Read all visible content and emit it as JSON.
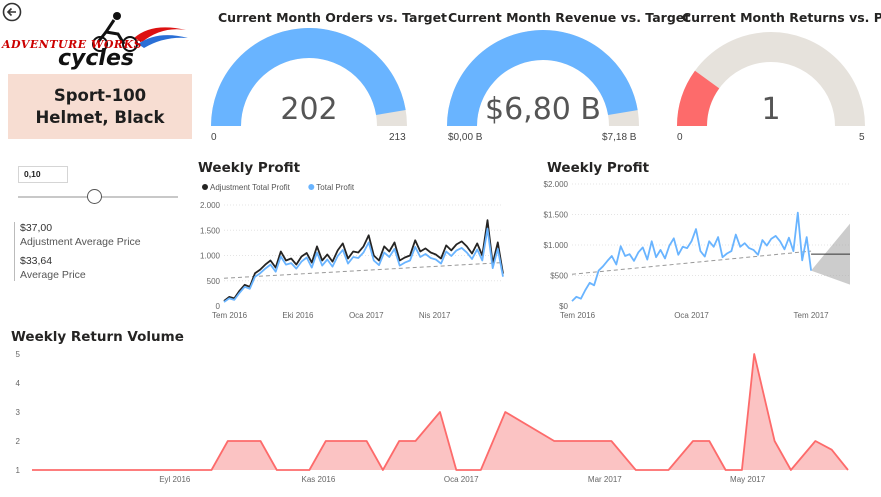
{
  "product": {
    "name": "Sport-100 Helmet, Black"
  },
  "logo": {
    "line1": "ADVENTURE WORKS",
    "line2": "cycles"
  },
  "slicer": {
    "value": "0,10",
    "fraction": 0.48
  },
  "cards": [
    {
      "value": "$37,00",
      "label": "Adjustment Average Price"
    },
    {
      "value": "$33,64",
      "label": "Average Price"
    }
  ],
  "gauges": [
    {
      "title": "Current Month Orders vs. Target",
      "value_text": "202",
      "min_label": "0",
      "max_label": "213",
      "fraction": 0.948,
      "color": "#69b4ff",
      "track": "#e6e2dc"
    },
    {
      "title": "Current Month Revenue vs. Target",
      "value_text": "$6,80 B",
      "min_label": "$0,00 B",
      "max_label": "$7,18 B",
      "fraction": 0.947,
      "color": "#69b4ff",
      "track": "#e6e2dc"
    },
    {
      "title": "Current Month Returns vs. Prev",
      "value_text": "1",
      "min_label": "0",
      "max_label": "5",
      "fraction": 0.2,
      "color": "#fd6b6b",
      "track": "#e6e2dc"
    }
  ],
  "chart_data": [
    {
      "type": "line",
      "title": "Weekly Profit",
      "legend": [
        "Adjustment Total Profit",
        "Total Profit"
      ],
      "legend_position": "top-left",
      "colors": [
        "#252423",
        "#69b4ff"
      ],
      "ylim": [
        0,
        2000
      ],
      "yticks": [
        "0",
        "500",
        "1.000",
        "1.500",
        "2.000"
      ],
      "ytick_values": [
        0,
        500,
        1000,
        1500,
        2000
      ],
      "xticks": [
        {
          "label": "Tem 2016",
          "x": 0.02
        },
        {
          "label": "Eki 2016",
          "x": 0.265
        },
        {
          "label": "Oca 2017",
          "x": 0.51
        },
        {
          "label": "Nis 2017",
          "x": 0.755
        }
      ],
      "grid": true,
      "trend": [
        550,
        860
      ],
      "series": [
        {
          "name": "Adjustment Total Profit",
          "values": [
            100,
            180,
            150,
            300,
            420,
            380,
            650,
            720,
            820,
            900,
            760,
            1080,
            900,
            940,
            820,
            980,
            1050,
            860,
            1180,
            900,
            1020,
            880,
            1100,
            1240,
            940,
            1080,
            1060,
            1180,
            1400,
            1000,
            900,
            1180,
            1080,
            1260,
            900,
            960,
            1000,
            1300,
            1080,
            1140,
            1060,
            1020,
            940,
            1200,
            1100,
            1220,
            1280,
            1180,
            1040,
            1240,
            1000,
            1700,
            840,
            1260,
            640
          ]
        },
        {
          "name": "Total Profit",
          "values": [
            80,
            150,
            120,
            260,
            380,
            340,
            580,
            650,
            740,
            820,
            680,
            980,
            820,
            850,
            740,
            880,
            960,
            760,
            1060,
            800,
            920,
            780,
            990,
            1110,
            840,
            970,
            950,
            1060,
            1260,
            900,
            810,
            1060,
            970,
            1130,
            800,
            860,
            900,
            1170,
            970,
            1030,
            950,
            920,
            840,
            1080,
            990,
            1100,
            1150,
            1060,
            930,
            1120,
            900,
            1530,
            750,
            1130,
            580
          ]
        }
      ]
    },
    {
      "type": "line",
      "title": "Weekly Profit",
      "legend": [],
      "colors": [
        "#69b4ff"
      ],
      "ylim": [
        0,
        2000
      ],
      "yticks": [
        "$0",
        "$500",
        "$1.000",
        "$1.500",
        "$2.000"
      ],
      "ytick_values": [
        0,
        500,
        1000,
        1500,
        2000
      ],
      "xticks": [
        {
          "label": "Tem 2016",
          "x": 0.02
        },
        {
          "label": "Oca 2017",
          "x": 0.43
        },
        {
          "label": "Tem 2017",
          "x": 0.86
        }
      ],
      "grid": true,
      "trend": [
        520,
        900
      ],
      "forecast": {
        "value": 850,
        "low": 350,
        "high": 1350,
        "start": 0.86,
        "end": 1.0
      },
      "series": [
        {
          "name": "Total Profit",
          "values": [
            80,
            150,
            120,
            260,
            380,
            340,
            580,
            650,
            740,
            820,
            680,
            980,
            820,
            850,
            740,
            880,
            960,
            760,
            1060,
            800,
            920,
            780,
            990,
            1110,
            840,
            970,
            950,
            1060,
            1260,
            900,
            810,
            1060,
            970,
            1130,
            800,
            860,
            900,
            1170,
            970,
            1030,
            950,
            920,
            840,
            1080,
            990,
            1100,
            1150,
            1060,
            930,
            1120,
            900,
            1530,
            750,
            1130,
            580
          ]
        }
      ]
    },
    {
      "type": "area",
      "title": "Weekly Return Volume",
      "legend": [],
      "colors": [
        "#fd6b6b",
        "#fbbcbc"
      ],
      "ylim": [
        1,
        5
      ],
      "yticks": [
        "1",
        "2",
        "3",
        "4",
        "5"
      ],
      "ytick_values": [
        1,
        2,
        3,
        4,
        5
      ],
      "xticks": [
        {
          "label": "Eyl 2016",
          "x": 0.175
        },
        {
          "label": "Kas 2016",
          "x": 0.351
        },
        {
          "label": "Oca 2017",
          "x": 0.526
        },
        {
          "label": "Mar 2017",
          "x": 0.702
        },
        {
          "label": "May 2017",
          "x": 0.877
        }
      ],
      "grid": false,
      "points": [
        {
          "x": 0.0,
          "y": 1
        },
        {
          "x": 0.22,
          "y": 1
        },
        {
          "x": 0.24,
          "y": 2
        },
        {
          "x": 0.28,
          "y": 2
        },
        {
          "x": 0.3,
          "y": 1
        },
        {
          "x": 0.34,
          "y": 1
        },
        {
          "x": 0.36,
          "y": 2
        },
        {
          "x": 0.41,
          "y": 2
        },
        {
          "x": 0.43,
          "y": 1
        },
        {
          "x": 0.45,
          "y": 2
        },
        {
          "x": 0.47,
          "y": 2
        },
        {
          "x": 0.5,
          "y": 3
        },
        {
          "x": 0.52,
          "y": 1
        },
        {
          "x": 0.55,
          "y": 1
        },
        {
          "x": 0.58,
          "y": 3
        },
        {
          "x": 0.64,
          "y": 2
        },
        {
          "x": 0.71,
          "y": 2
        },
        {
          "x": 0.74,
          "y": 1
        },
        {
          "x": 0.78,
          "y": 1
        },
        {
          "x": 0.81,
          "y": 2
        },
        {
          "x": 0.83,
          "y": 2
        },
        {
          "x": 0.85,
          "y": 1
        },
        {
          "x": 0.87,
          "y": 1
        },
        {
          "x": 0.885,
          "y": 5
        },
        {
          "x": 0.91,
          "y": 2
        },
        {
          "x": 0.93,
          "y": 1
        },
        {
          "x": 0.96,
          "y": 2
        },
        {
          "x": 0.98,
          "y": 1.7
        },
        {
          "x": 1.0,
          "y": 1
        }
      ]
    }
  ]
}
